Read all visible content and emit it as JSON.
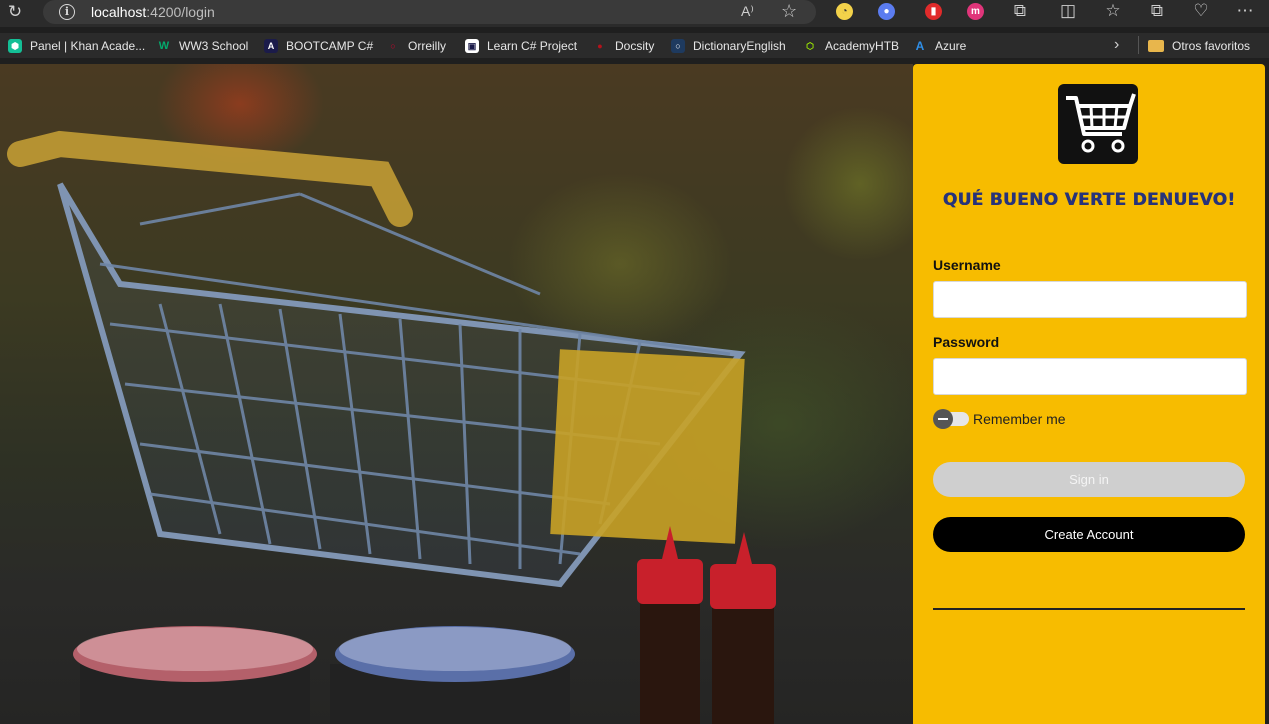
{
  "browser": {
    "url_host": "localhost",
    "url_path": ":4200/login",
    "bookmarks": [
      {
        "label": "Panel | Khan Acade...",
        "color": "#14bf96"
      },
      {
        "label": "WW3 School",
        "color": "#04aa6d"
      },
      {
        "label": "BOOTCAMP C#",
        "color": "#1b1b4a"
      },
      {
        "label": "Orreilly",
        "color": "#d3002d"
      },
      {
        "label": "Learn C# Project",
        "color": "#ffffff"
      },
      {
        "label": "Docsity",
        "color": "#b5121b"
      },
      {
        "label": "DictionaryEnglish",
        "color": "#1e3a5f"
      },
      {
        "label": "AcademyHTB",
        "color": "#9fef00"
      },
      {
        "label": "Azure",
        "color": "#0078d4"
      }
    ],
    "other_favorites": "Otros favoritos"
  },
  "login": {
    "title": "QUÉ BUENO VERTE DENUEVO!",
    "username_label": "Username",
    "username_value": "",
    "password_label": "Password",
    "password_value": "",
    "remember_label": "Remember me",
    "signin_label": "Sign in",
    "create_label": "Create Account"
  },
  "colors": {
    "panel": "#f7bc00",
    "title": "#27337a",
    "create_button": "#000000",
    "signin_disabled": "#cfcfcf"
  }
}
